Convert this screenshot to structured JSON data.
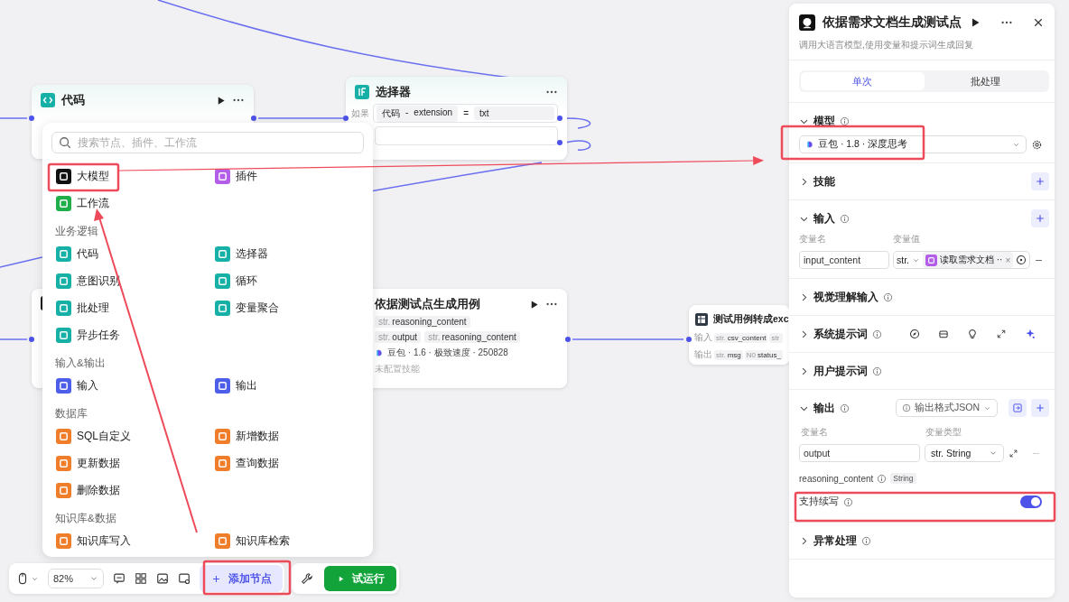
{
  "canvas": {
    "nodes": [
      {
        "kind": "code",
        "title": "代码"
      },
      {
        "kind": "selector",
        "title": "选择器",
        "condition_label": "如果",
        "condition": {
          "source": "代码",
          "separator": "-",
          "field": "extension",
          "operator": "=",
          "value": "txt"
        }
      },
      {
        "kind": "hidden"
      },
      {
        "kind": "llm",
        "title": "依据测试点生成用例",
        "input_tags": [
          {
            "type": "str.",
            "name": "reasoning_content"
          }
        ],
        "output_tags": [
          {
            "type": "str.",
            "name": "output"
          },
          {
            "type": "str.",
            "name": "reasoning_content"
          }
        ],
        "model": "豆包 · 1.6 · 极致速度 · 250828",
        "skills": "未配置技能"
      },
      {
        "kind": "tool",
        "title": "测试用例转成exc",
        "rows": [
          {
            "label": "输入",
            "tags": [
              {
                "type": "str.",
                "name": "csv_content"
              },
              {
                "type": "str"
              }
            ]
          },
          {
            "label": "输出",
            "tags": [
              {
                "type": "str.",
                "name": "msg"
              },
              {
                "type": "N0",
                "name": "status_"
              }
            ]
          }
        ]
      }
    ]
  },
  "node_menu": {
    "search": {
      "placeholder": "搜索节点、插件、工作流"
    },
    "sections": [
      {
        "items": [
          {
            "label": "大模型",
            "color": "#111111"
          },
          {
            "label": "插件",
            "color": "#b35de8"
          },
          {
            "label": "工作流",
            "color": "#1fae4a"
          }
        ]
      },
      {
        "title": "业务逻辑",
        "items": [
          {
            "label": "代码",
            "color": "#17b0a6"
          },
          {
            "label": "选择器",
            "color": "#17b0a6"
          },
          {
            "label": "意图识别",
            "color": "#17b0a6"
          },
          {
            "label": "循环",
            "color": "#17b0a6"
          },
          {
            "label": "批处理",
            "color": "#17b0a6"
          },
          {
            "label": "变量聚合",
            "color": "#17b0a6"
          },
          {
            "label": "异步任务",
            "color": "#17b0a6"
          }
        ]
      },
      {
        "title": "输入&输出",
        "items": [
          {
            "label": "输入",
            "color": "#4d5ee8"
          },
          {
            "label": "输出",
            "color": "#4d5ee8"
          }
        ]
      },
      {
        "title": "数据库",
        "items": [
          {
            "label": "SQL自定义",
            "color": "#f07d2a"
          },
          {
            "label": "新增数据",
            "color": "#f07d2a"
          },
          {
            "label": "更新数据",
            "color": "#f07d2a"
          },
          {
            "label": "查询数据",
            "color": "#f07d2a"
          },
          {
            "label": "删除数据",
            "color": "#f07d2a"
          }
        ]
      },
      {
        "title": "知识库&数据",
        "items": [
          {
            "label": "知识库写入",
            "color": "#f07d2a"
          },
          {
            "label": "知识库检索",
            "color": "#f07d2a"
          }
        ]
      }
    ]
  },
  "panel": {
    "title": "依据需求文档生成测试点",
    "subtitle": "调用大语言模型,使用变量和提示词生成回复",
    "tabs": [
      {
        "label": "单次",
        "selected": true
      },
      {
        "label": "批处理",
        "selected": false
      }
    ],
    "sections": [
      {
        "kind": "model",
        "title": "模型",
        "expanded": true,
        "info": true,
        "add": false,
        "value": "豆包 · 1.8 · 深度思考"
      },
      {
        "kind": "skills",
        "title": "技能",
        "expanded": false,
        "info": false,
        "add": true
      },
      {
        "kind": "inputs",
        "title": "输入",
        "expanded": true,
        "info": true,
        "add": true,
        "name_label": "变量名",
        "value_label": "变量值",
        "rows": [
          {
            "name": "input_content",
            "type": "str.",
            "ref": "读取需求文档 ··",
            "remove": "×"
          }
        ]
      },
      {
        "kind": "plain",
        "title": "视觉理解输入",
        "expanded": false,
        "info": true,
        "add": false
      },
      {
        "kind": "system_prompt",
        "title": "系统提示词",
        "expanded": false,
        "info": true,
        "add": false
      },
      {
        "kind": "plain",
        "title": "用户提示词",
        "expanded": false,
        "info": true,
        "add": false
      },
      {
        "kind": "outputs",
        "title": "输出",
        "expanded": true,
        "info": true,
        "add": true,
        "format": "输出格式JSON",
        "name_label": "变量名",
        "type_label": "变量类型",
        "rows": [
          {
            "name": "output",
            "type": "str. String"
          }
        ],
        "extra": {
          "name": "reasoning_content",
          "type": "String"
        },
        "toggle": {
          "label": "支持续写",
          "on": true
        }
      },
      {
        "kind": "plain",
        "title": "异常处理",
        "expanded": false,
        "info": true,
        "add": false
      }
    ]
  },
  "toolbar": {
    "zoom": "82%",
    "add_node": "添加节点",
    "run": "试运行"
  }
}
